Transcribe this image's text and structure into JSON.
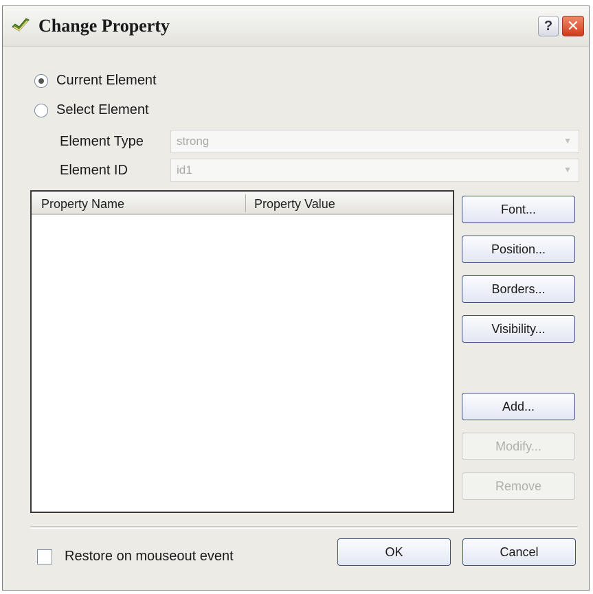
{
  "window": {
    "title": "Change Property",
    "help_label": "?",
    "close_label": "✕"
  },
  "radios": {
    "current_element": {
      "label": "Current Element",
      "checked": true
    },
    "select_element": {
      "label": "Select Element",
      "checked": false
    }
  },
  "fields": {
    "element_type": {
      "label": "Element Type",
      "value": "strong"
    },
    "element_id": {
      "label": "Element ID",
      "value": "id1"
    }
  },
  "property_list": {
    "columns": [
      "Property Name",
      "Property Value"
    ],
    "rows": []
  },
  "side_buttons": {
    "font": "Font...",
    "position": "Position...",
    "borders": "Borders...",
    "visibility": "Visibility...",
    "add": "Add...",
    "modify": "Modify...",
    "remove": "Remove"
  },
  "footer": {
    "restore_checkbox_label": "Restore on mouseout event",
    "restore_checked": false,
    "ok": "OK",
    "cancel": "Cancel"
  }
}
